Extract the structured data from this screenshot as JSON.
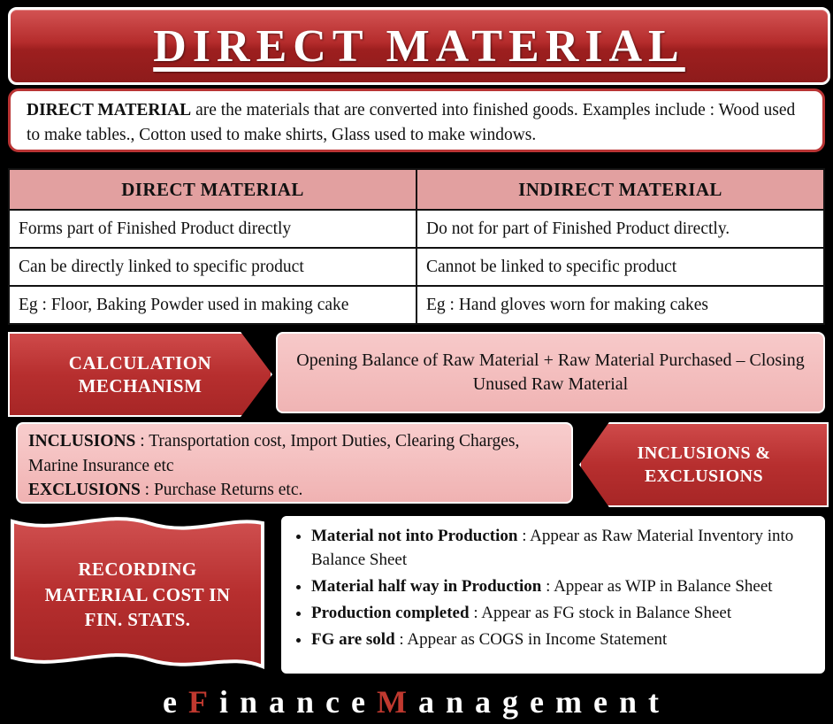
{
  "title": "DIRECT MATERIAL",
  "definition": {
    "lead": "DIRECT MATERIAL",
    "text": " are the materials that are converted into finished goods. Examples include : Wood used to make tables., Cotton used to make shirts, Glass used to make windows."
  },
  "comparison": {
    "headers": [
      "DIRECT MATERIAL",
      "INDIRECT MATERIAL"
    ],
    "rows": [
      [
        "Forms part of Finished Product directly",
        "Do not for part of Finished Product directly."
      ],
      [
        "Can be directly linked to specific product",
        "Cannot be linked to specific product"
      ],
      [
        "Eg : Floor, Baking Powder used in making cake",
        "Eg : Hand gloves worn for making cakes"
      ]
    ]
  },
  "calculation": {
    "label": "CALCULATION MECHANISM",
    "formula": "Opening Balance of Raw Material + Raw Material Purchased – Closing Unused Raw Material"
  },
  "inclusions": {
    "label": "INCLUSIONS & EXCLUSIONS",
    "inclusions_lead": "INCLUSIONS",
    "inclusions_text": " : Transportation cost, Import Duties, Clearing Charges, Marine Insurance etc",
    "exclusions_lead": "EXCLUSIONS",
    "exclusions_text": " : Purchase Returns  etc."
  },
  "recording": {
    "label": "RECORDING MATERIAL COST IN FIN. STATS.",
    "items": [
      {
        "lead": "Material not into Production",
        "text": " : Appear as Raw Material Inventory into Balance Sheet"
      },
      {
        "lead": "Material half way in Production",
        "text": " : Appear as WIP in Balance Sheet"
      },
      {
        "lead": "Production completed",
        "text": " : Appear as FG stock in Balance Sheet"
      },
      {
        "lead": "FG are sold",
        "text": " : Appear as COGS in Income Statement"
      }
    ]
  },
  "brand": {
    "parts": [
      {
        "t": "e",
        "c": "white"
      },
      {
        "t": "F",
        "c": "red"
      },
      {
        "t": "i",
        "c": "white"
      },
      {
        "t": "n",
        "c": "white"
      },
      {
        "t": "a",
        "c": "white"
      },
      {
        "t": "n",
        "c": "white"
      },
      {
        "t": "c",
        "c": "white"
      },
      {
        "t": "e",
        "c": "white"
      },
      {
        "t": "M",
        "c": "red"
      },
      {
        "t": "a",
        "c": "white"
      },
      {
        "t": "n",
        "c": "white"
      },
      {
        "t": "a",
        "c": "white"
      },
      {
        "t": "g",
        "c": "white"
      },
      {
        "t": "e",
        "c": "white"
      },
      {
        "t": "m",
        "c": "white"
      },
      {
        "t": "e",
        "c": "white"
      },
      {
        "t": "n",
        "c": "white"
      },
      {
        "t": "t",
        "c": "white"
      }
    ]
  },
  "colors": {
    "background": "#000000",
    "accent_red": "#b52c2c",
    "header_pink": "#e2a0a0",
    "panel_pink": "#f4bfbf",
    "brand_red": "#c0392f"
  }
}
